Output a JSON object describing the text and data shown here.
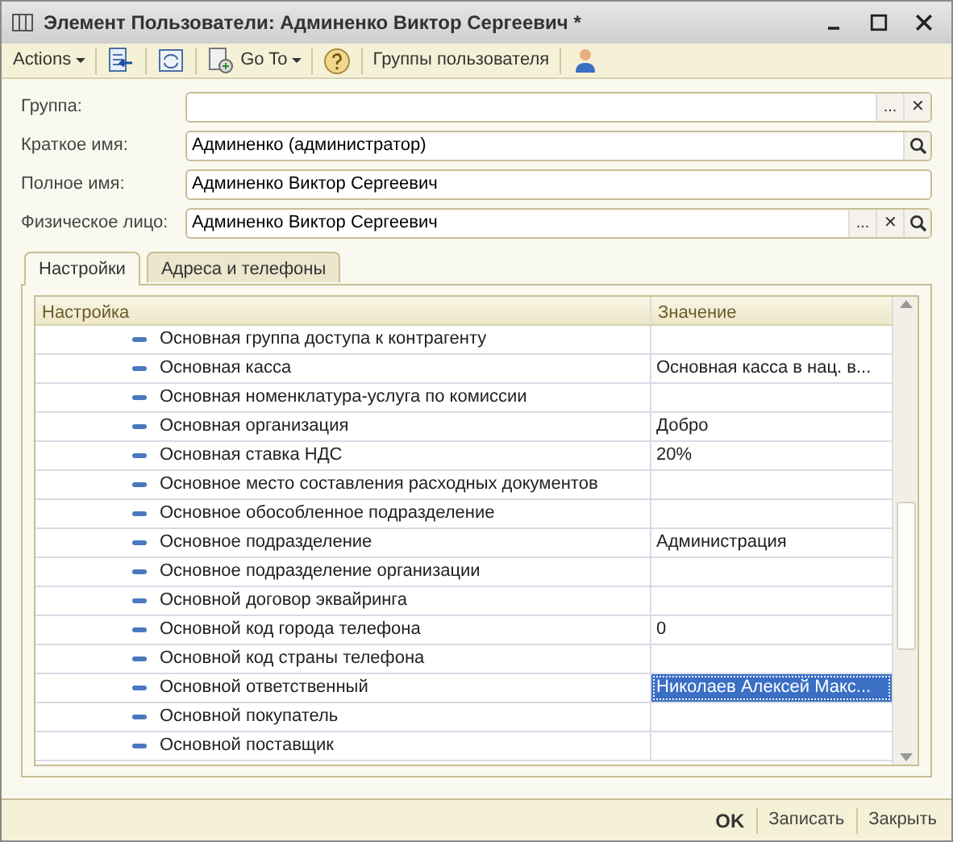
{
  "window": {
    "title": "Элемент Пользователи: Админенко Виктор Сергеевич *"
  },
  "toolbar": [
    {
      "kind": "menu",
      "label": "Actions"
    },
    {
      "kind": "icon"
    },
    {
      "kind": "icon"
    },
    {
      "kind": "menu",
      "label": "Go To"
    },
    {
      "kind": "icon"
    },
    {
      "kind": "text",
      "label": "Группы пользователя"
    },
    {
      "kind": "icon"
    }
  ],
  "fields": [
    {
      "label": "Группа:",
      "buttons": [
        "...",
        "✕"
      ]
    },
    {
      "label": "Краткое имя:",
      "value": "Админенко (администратор)",
      "lookup": true
    },
    {
      "label": "Полное имя:",
      "value": "Админенко Виктор Сергеевич"
    },
    {
      "label": "Физическое лицо:",
      "value": "Админенко Виктор Сергеевич",
      "buttons": [
        "...",
        "✕"
      ],
      "lookup": true
    }
  ],
  "tabs": [
    {
      "label": "Настройки",
      "selected": true
    },
    {
      "label": "Адреса и телефоны",
      "selected": false
    }
  ],
  "table": {
    "columns": [
      "Настройка",
      "Значение"
    ],
    "rows": [
      {
        "setting": "Основная группа доступа к контрагенту",
        "selected": false
      },
      {
        "setting": "Основная касса",
        "value": "Основная касса в нац. в...",
        "selected": false
      },
      {
        "setting": "Основная номенклатура-услуга по комиссии",
        "selected": false
      },
      {
        "setting": "Основная организация",
        "value": "Добро",
        "selected": false
      },
      {
        "setting": "Основная ставка НДС",
        "value": "20%",
        "selected": false
      },
      {
        "setting": "Основное место составления расходных документов",
        "selected": false
      },
      {
        "setting": "Основное обособленное подразделение",
        "selected": false
      },
      {
        "setting": "Основное подразделение",
        "value": "Администрация",
        "selected": false
      },
      {
        "setting": "Основное подразделение организации",
        "selected": false
      },
      {
        "setting": "Основной договор эквайринга",
        "selected": false
      },
      {
        "setting": "Основной код города телефона",
        "value": "0",
        "selected": false
      },
      {
        "setting": "Основной код страны телефона",
        "selected": false
      },
      {
        "setting": "Основной ответственный",
        "value": "Николаев Алексей Макс...",
        "selected": true
      },
      {
        "setting": "Основной покупатель",
        "selected": false
      },
      {
        "setting": "Основной поставщик",
        "selected": false
      }
    ]
  },
  "footer": [
    {
      "label": "OK",
      "kind": "default"
    },
    {
      "label": "Записать",
      "kind": "normal"
    },
    {
      "label": "Закрыть",
      "kind": "normal"
    }
  ]
}
